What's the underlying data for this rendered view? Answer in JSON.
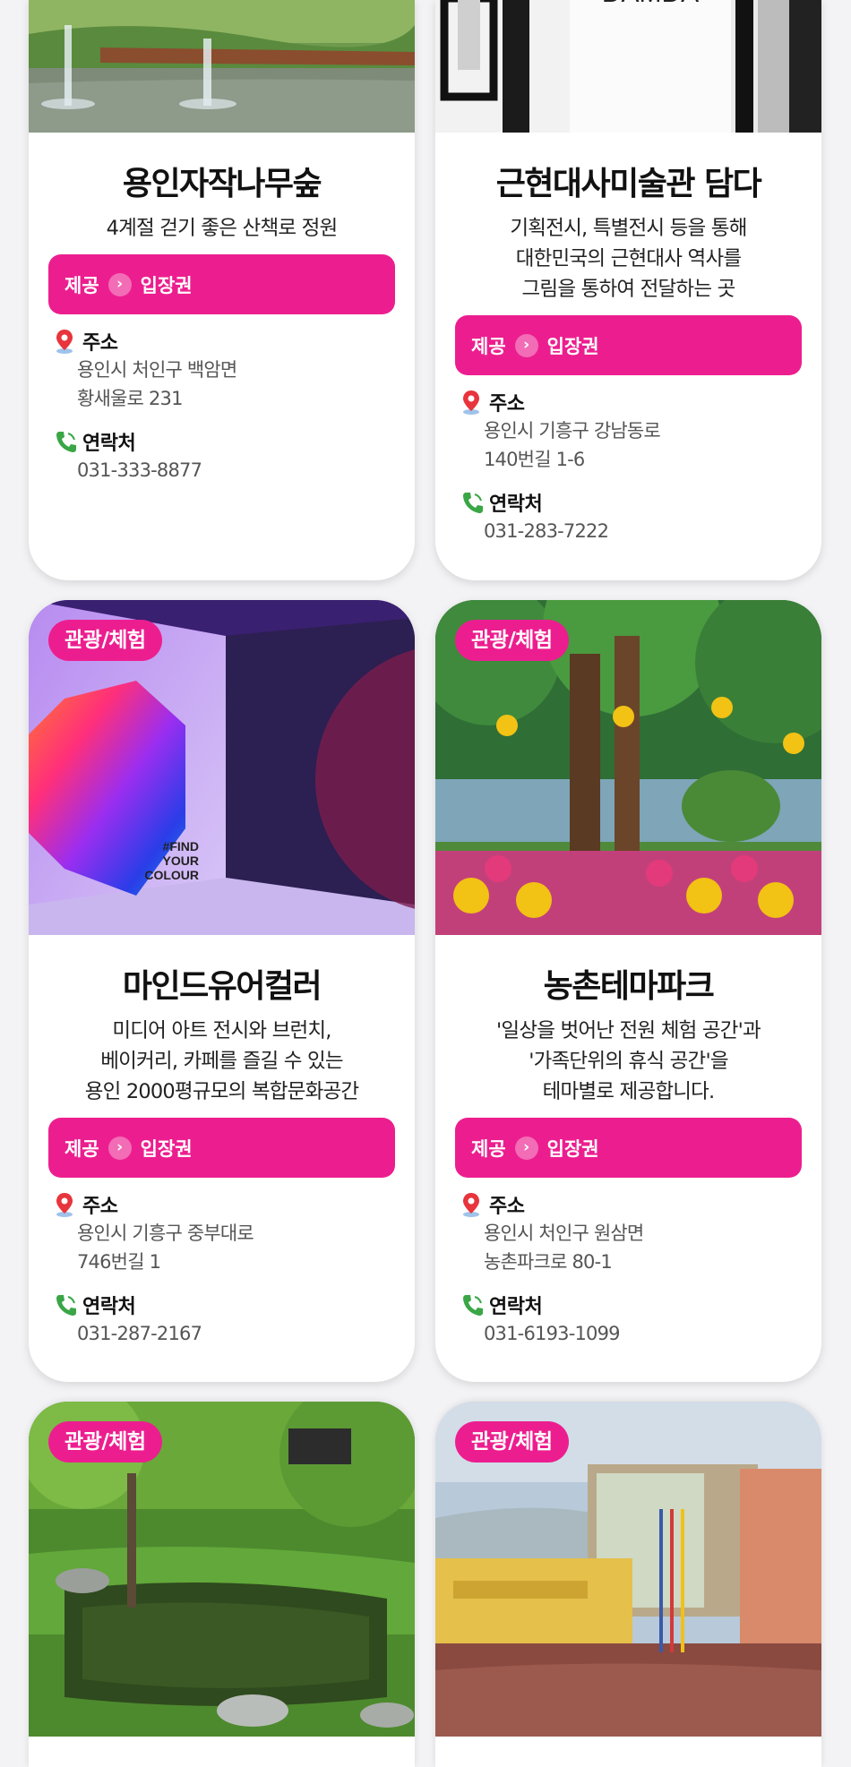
{
  "cards": [
    {
      "title": "용인자작나무숲",
      "desc": [
        "4계절 걷기 좋은 산책로 정원"
      ],
      "offer_left": "제공",
      "offer_right": "입장권",
      "address_label": "주소",
      "address": [
        "용인시 처인구 백암면",
        "황새울로 231"
      ],
      "contact_label": "연락처",
      "phone": "031-333-8877"
    },
    {
      "title": "근현대사미술관 담다",
      "photo_text": "DAMDA",
      "desc": [
        "기획전시, 특별전시 등을 통해",
        "대한민국의 근현대사 역사를",
        "그림을 통하여 전달하는 곳"
      ],
      "offer_left": "제공",
      "offer_right": "입장권",
      "address_label": "주소",
      "address": [
        "용인시 기흥구 강남동로",
        "140번길 1-6"
      ],
      "contact_label": "연락처",
      "phone": "031-283-7222"
    },
    {
      "tag": "관광/체험",
      "title": "마인드유어컬러",
      "photo_text": [
        "#FIND",
        "YOUR",
        "COLOUR"
      ],
      "desc": [
        "미디어 아트 전시와 브런치,",
        "베이커리, 카페를 즐길 수 있는",
        "용인 2000평규모의 복합문화공간"
      ],
      "offer_left": "제공",
      "offer_right": "입장권",
      "address_label": "주소",
      "address": [
        "용인시 기흥구 중부대로",
        "746번길 1"
      ],
      "contact_label": "연락처",
      "phone": "031-287-2167"
    },
    {
      "tag": "관광/체험",
      "title": "농촌테마파크",
      "desc": [
        "'일상을 벗어난 전원 체험 공간'과",
        "'가족단위의 휴식 공간'을",
        "테마별로 제공합니다."
      ],
      "offer_left": "제공",
      "offer_right": "입장권",
      "address_label": "주소",
      "address": [
        "용인시 처인구 원삼면",
        "농촌파크로 80-1"
      ],
      "contact_label": "연락처",
      "phone": "031-6193-1099"
    },
    {
      "tag": "관광/체험"
    },
    {
      "tag": "관광/체험"
    }
  ],
  "colors": {
    "accent": "#ec1e8f",
    "pin": "#e8343c",
    "phone": "#3aa646"
  }
}
